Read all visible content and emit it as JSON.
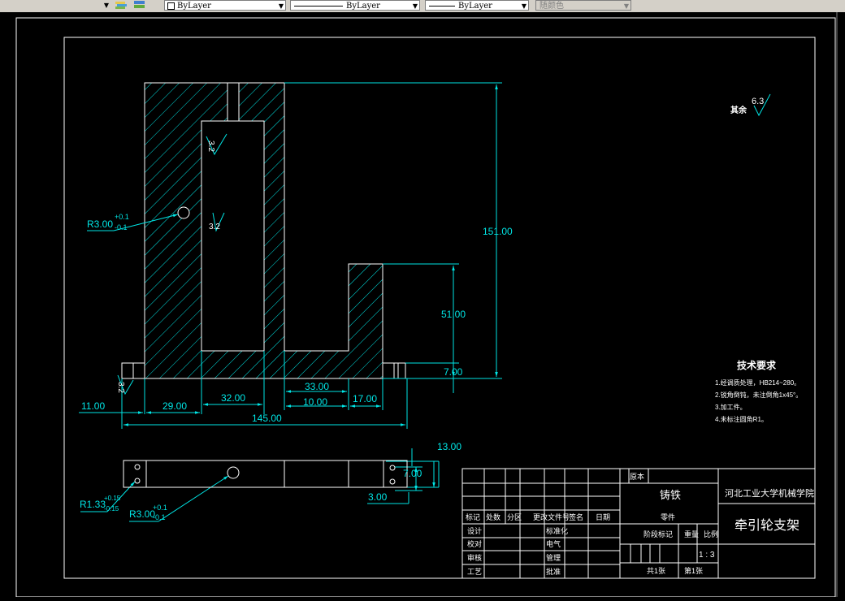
{
  "toolbar": {
    "layer_label": "ByLayer",
    "linetype_label": "ByLayer",
    "lineweight_label": "ByLayer",
    "color_label": "随颜色"
  },
  "colors": {
    "background": "#000000",
    "lines": "#ffffff",
    "dimensions": "#00e5e5",
    "toolbar": "#d4d0c8"
  },
  "dims": {
    "d151": "151.00",
    "d51": "51.00",
    "d7": "7.00",
    "d11": "11.00",
    "d29": "29.00",
    "d32": "32.00",
    "d33": "33.00",
    "d10": "10.00",
    "d17": "17.00",
    "d145": "145.00",
    "d13": "13.00",
    "d7b": "7.00",
    "d3": "3.00"
  },
  "annotations": {
    "r3_top": "R3.00",
    "r3_top_plus": "+0.1",
    "r3_top_minus": "-0.1",
    "r3_bottom": "R3.00",
    "r3_bottom_plus": "+0.1",
    "r3_bottom_minus": "-0.1",
    "r133": "R1.33",
    "r133_plus": "+0.15",
    "r133_minus": "-0.15",
    "rough1": "3.2",
    "rough2": "3.2",
    "rough3": "3.2",
    "rest_label": "其余",
    "rest_value": "6.3"
  },
  "tech": {
    "title": "技术要求",
    "items": [
      "1.经调质处理，HB214~280。",
      "2.锐角倒钝，未注倒角1x45°。",
      "3.加工件。",
      "4.未标注圆角R1。"
    ]
  },
  "title_block": {
    "material_header": "原本",
    "material": "铸铁",
    "school": "河北工业大学机械学院",
    "part_name": "牵引轮支架",
    "part_sub": "零件",
    "stage_label": "阶段标记",
    "weight_label": "重量",
    "scale_label": "比例",
    "scale": "1 : 3",
    "sheets": "共1张",
    "sheet": "第1张",
    "row_mark": "标记",
    "row_count": "处数",
    "row_zone": "分区",
    "row_doc": "更改文件号",
    "row_sign": "签名",
    "row_date": "日期",
    "designer": "设计",
    "check": "校对",
    "review": "审核",
    "process": "工艺",
    "std": "标准化",
    "approve": "批准",
    "elec": "电气",
    "mgr": "管理"
  }
}
